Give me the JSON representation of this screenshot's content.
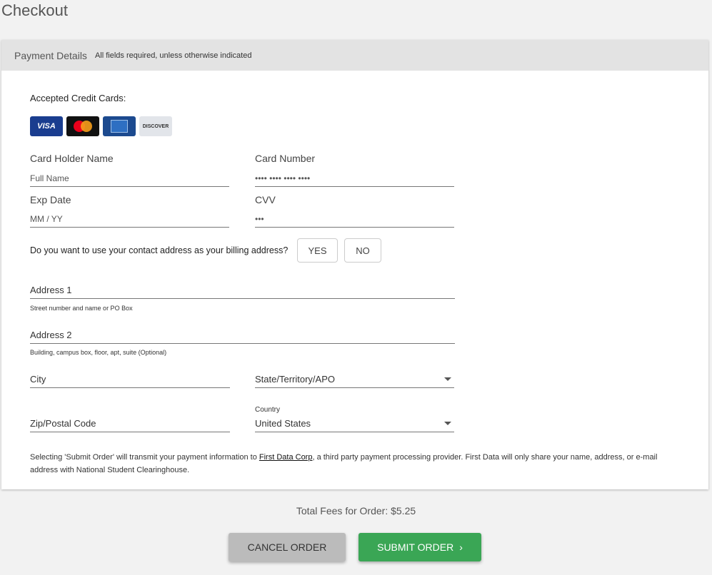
{
  "page": {
    "title": "Checkout"
  },
  "payment": {
    "header_title": "Payment Details",
    "header_note": "All fields required, unless otherwise indicated",
    "accepted_label": "Accepted Credit Cards:",
    "cards": [
      {
        "name": "visa-card-icon",
        "label": "VISA"
      },
      {
        "name": "mastercard-icon",
        "label": "mastercard"
      },
      {
        "name": "amex-card-icon",
        "label": ""
      },
      {
        "name": "discover-card-icon",
        "label": "DISCOVER"
      }
    ],
    "holder_label": "Card Holder Name",
    "holder_placeholder": "Full Name",
    "number_label": "Card Number",
    "number_placeholder": "•••• •••• •••• ••••",
    "exp_label": "Exp Date",
    "exp_placeholder": "MM / YY",
    "cvv_label": "CVV",
    "cvv_placeholder": "•••",
    "billing_question": "Do you want to use your contact address as your billing address?",
    "yes_label": "YES",
    "no_label": "NO",
    "address1_label": "Address 1",
    "address1_hint": "Street number and name or PO Box",
    "address2_label": "Address 2",
    "address2_hint": "Building, campus box, floor, apt, suite (Optional)",
    "city_label": "City",
    "state_label": "State/Territory/APO",
    "zip_label": "Zip/Postal Code",
    "country_label": "Country",
    "country_value": "United States",
    "disclaimer_before": "Selecting 'Submit Order' will transmit your payment information to ",
    "disclaimer_link": "First Data Corp",
    "disclaimer_after": ", a third party payment processing provider. First Data will only share your name, address, or e-mail address with National Student Clearinghouse."
  },
  "footer": {
    "total_text": "Total Fees for Order: $5.25",
    "cancel_label": "CANCEL ORDER",
    "submit_label": "SUBMIT ORDER",
    "submit_chevron": "›"
  },
  "colors": {
    "submit": "#3aa655",
    "cancel": "#bbbbbb",
    "header_bg": "#e3e3e3"
  }
}
